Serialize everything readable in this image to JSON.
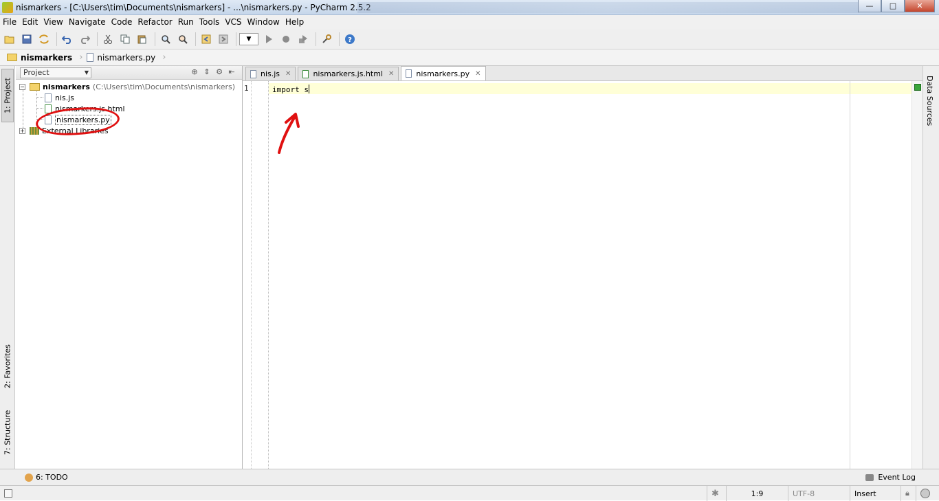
{
  "window": {
    "title": "nismarkers - [C:\\Users\\tim\\Documents\\nismarkers] - ...\\nismarkers.py - PyCharm 2.5.2",
    "buttons": {
      "minimize": "—",
      "maximize": "□",
      "close": "✕"
    }
  },
  "menu": {
    "items": [
      "File",
      "Edit",
      "View",
      "Navigate",
      "Code",
      "Refactor",
      "Run",
      "Tools",
      "VCS",
      "Window",
      "Help"
    ]
  },
  "toolbar": {
    "icons": [
      "open-icon",
      "save-icon",
      "sync-icon",
      "undo-icon",
      "redo-icon",
      "cut-icon",
      "copy-icon",
      "paste-icon",
      "find-icon",
      "replace-icon",
      "back-icon",
      "forward-icon",
      "run-config-combo",
      "run-icon",
      "debug-icon",
      "coverage-icon",
      "settings-icon",
      "help-icon"
    ],
    "combo_caret": "▼"
  },
  "breadcrumb": {
    "items": [
      "nismarkers",
      "nismarkers.py"
    ]
  },
  "left_strip": {
    "project_tab": "1: Project",
    "favorites_tab": "2: Favorites",
    "structure_tab": "7: Structure"
  },
  "right_strip": {
    "data_sources_tab": "Data Sources"
  },
  "project_panel": {
    "view_combo": "Project",
    "tree": {
      "root": {
        "name": "nismarkers",
        "path": "(C:\\Users\\tim\\Documents\\nismarkers)",
        "expander": "−"
      },
      "children": [
        "nis.js",
        "nismarkers.js.html",
        "nismarkers.py"
      ],
      "external": {
        "name": "External Libraries",
        "expander": "+"
      }
    }
  },
  "editor": {
    "tabs": [
      {
        "label": "nis.js",
        "close": "✕"
      },
      {
        "label": "nismarkers.js.html",
        "close": "✕"
      },
      {
        "label": "nismarkers.py",
        "close": "✕"
      }
    ],
    "line_number": "1",
    "code": "import s"
  },
  "bottom": {
    "todo": "6: TODO",
    "event_log": "Event Log"
  },
  "status": {
    "position": "1:9",
    "encoding": "UTF-8",
    "mode": "Insert"
  },
  "colors": {
    "annotation": "#e01010",
    "current_line": "#ffffd7",
    "inspection_ok": "#3aa63a"
  }
}
